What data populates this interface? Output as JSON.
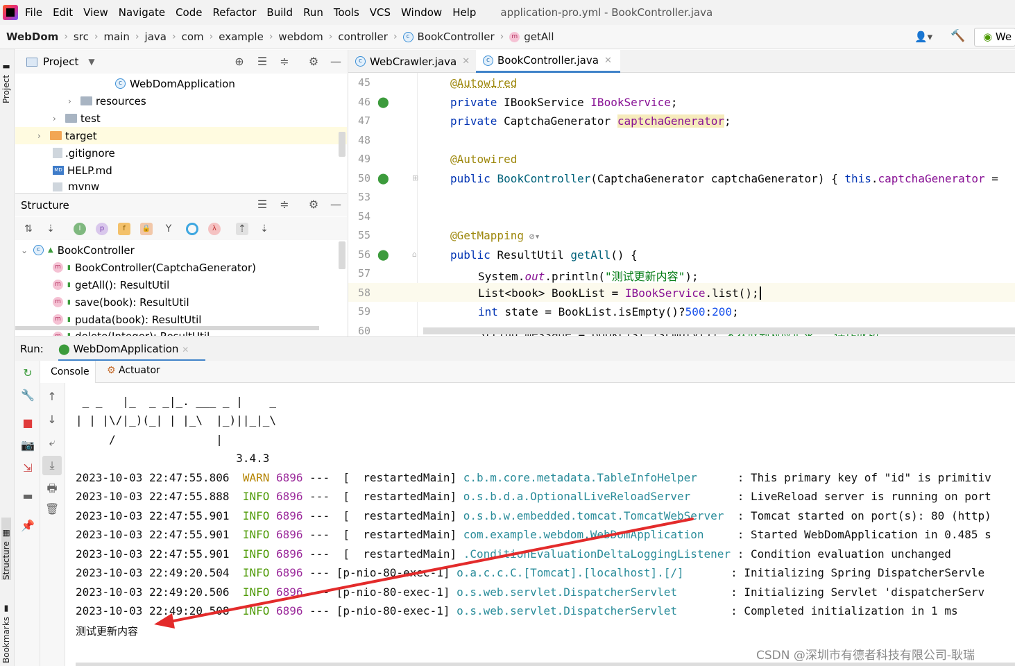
{
  "menubar": {
    "items": [
      "File",
      "Edit",
      "View",
      "Navigate",
      "Code",
      "Refactor",
      "Build",
      "Run",
      "Tools",
      "VCS",
      "Window",
      "Help"
    ],
    "title": "application-pro.yml - BookController.java"
  },
  "navbar": {
    "crumbs": [
      "WebDom",
      "src",
      "main",
      "java",
      "com",
      "example",
      "webdom",
      "controller",
      "BookController",
      "getAll"
    ],
    "right_tab": "We"
  },
  "left_stripe": {
    "project": "Project",
    "structure": "Structure",
    "bookmarks": "Bookmarks"
  },
  "project_panel": {
    "title": "Project",
    "items": [
      {
        "label": "WebDomApplication",
        "kind": "class"
      },
      {
        "label": "resources",
        "kind": "folder"
      },
      {
        "label": "test",
        "kind": "folder"
      },
      {
        "label": "target",
        "kind": "folder-orange"
      },
      {
        "label": ".gitignore",
        "kind": "file"
      },
      {
        "label": "HELP.md",
        "kind": "md"
      },
      {
        "label": "mvnw",
        "kind": "file"
      }
    ]
  },
  "structure_panel": {
    "title": "Structure",
    "root": "BookController",
    "members": [
      "BookController(CaptchaGenerator)",
      "getAll(): ResultUtil",
      "save(book): ResultUtil",
      "pudata(book): ResultUtil",
      "delete(Integer): ResultUtil"
    ]
  },
  "editor": {
    "tabs": [
      {
        "label": "WebCrawler.java",
        "active": false
      },
      {
        "label": "BookController.java",
        "active": true
      }
    ],
    "line_numbers": [
      "45",
      "46",
      "47",
      "48",
      "49",
      "50",
      "53",
      "54",
      "55",
      "56",
      "57",
      "58",
      "59",
      "60"
    ],
    "lines": {
      "l45": "@Autowired",
      "l46a": "private ",
      "l46b": "IBookService ",
      "l46c": "IBookService",
      "l47a": "private ",
      "l47b": "CaptchaGenerator ",
      "l47c": "captchaGenerator",
      "l49": "@Autowired",
      "l50a": "public ",
      "l50b": "BookController",
      "l50c": "(CaptchaGenerator captchaGenerator) { ",
      "l50d": "this",
      ".": ".",
      "l50e": "captchaGenerator",
      "l50f": " =",
      "l55": "@GetMapping",
      "l56a": "public ",
      "l56b": "ResultUtil ",
      "l56c": "getAll",
      "l56d": "() {",
      "l57a": "System.",
      "l57b": "out",
      "l57c": ".println(",
      "l57d": "\"测试更新内容\"",
      "l57e": ");",
      "l58a": "List<book> BookList = ",
      "l58b": "IBookService",
      "l58c": ".list();",
      "l59a": "int ",
      "l59b": "state = BookList.isEmpty()?",
      "l59c": "500",
      ":": ":",
      "l59d": "200",
      "l59e": ";",
      "l60a": "String message = BookList.isEmpty()?",
      "l60b": "\"未获取到对应记录\"",
      "l60c": ":",
      "l60d": "\"操作成功\"",
      "l60e": ";"
    }
  },
  "run": {
    "label": "Run:",
    "config": "WebDomApplication",
    "tabs": [
      "Console",
      "Actuator"
    ],
    "banner": [
      " _ _   |_  _ _|_. ___ _ |    _ ",
      "| | |\\/|_)(_| | |_\\  |_)||_|_\\ ",
      "     /               |",
      "                        3.4.3"
    ],
    "logs": [
      {
        "ts": "2023-10-03 22:47:55.806",
        "level": "WARN",
        "pid": "6896",
        "thread": "---  [  restartedMain]",
        "logger": "c.b.m.core.metadata.TableInfoHelper     ",
        "msg": ": This primary key of \"id\" is primitiv"
      },
      {
        "ts": "2023-10-03 22:47:55.888",
        "level": "INFO",
        "pid": "6896",
        "thread": "---  [  restartedMain]",
        "logger": "o.s.b.d.a.OptionalLiveReloadServer      ",
        "msg": ": LiveReload server is running on port"
      },
      {
        "ts": "2023-10-03 22:47:55.901",
        "level": "INFO",
        "pid": "6896",
        "thread": "---  [  restartedMain]",
        "logger": "o.s.b.w.embedded.tomcat.TomcatWebServer ",
        "msg": ": Tomcat started on port(s): 80 (http)"
      },
      {
        "ts": "2023-10-03 22:47:55.901",
        "level": "INFO",
        "pid": "6896",
        "thread": "---  [  restartedMain]",
        "logger": "com.example.webdom.WebDomApplication    ",
        "msg": ": Started WebDomApplication in 0.485 s"
      },
      {
        "ts": "2023-10-03 22:47:55.901",
        "level": "INFO",
        "pid": "6896",
        "thread": "---  [  restartedMain]",
        "logger": ".ConditionEvaluationDeltaLoggingListener",
        "msg": ": Condition evaluation unchanged"
      },
      {
        "ts": "2023-10-03 22:49:20.504",
        "level": "INFO",
        "pid": "6896",
        "thread": "--- [p-nio-80-exec-1]",
        "logger": "o.a.c.c.C.[Tomcat].[localhost].[/]      ",
        "msg": ": Initializing Spring DispatcherServle"
      },
      {
        "ts": "2023-10-03 22:49:20.506",
        "level": "INFO",
        "pid": "6896",
        "thread": "--- [p-nio-80-exec-1]",
        "logger": "o.s.web.servlet.DispatcherServlet       ",
        "msg": ": Initializing Servlet 'dispatcherServ"
      },
      {
        "ts": "2023-10-03 22:49:20.508",
        "level": "INFO",
        "pid": "6896",
        "thread": "--- [p-nio-80-exec-1]",
        "logger": "o.s.web.servlet.DispatcherServlet       ",
        "msg": ": Completed initialization in 1 ms"
      }
    ],
    "output": "测试更新内容"
  },
  "watermark": "CSDN @深圳市有德者科技有限公司-耿瑞",
  "colors": {
    "accent": "#4083c9",
    "annotation": "#9e880d",
    "keyword": "#0033b3",
    "field": "#871094",
    "string": "#067d17",
    "arrow": "#e32b2b"
  }
}
